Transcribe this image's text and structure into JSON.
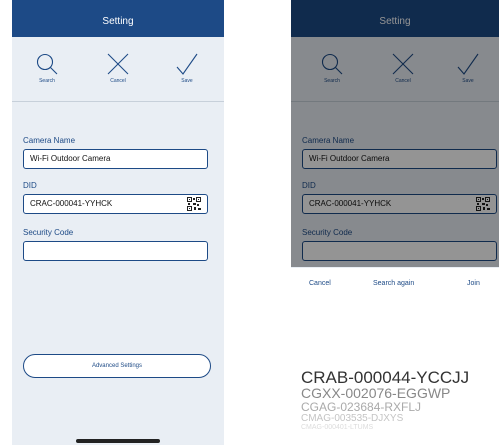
{
  "screen_a": {
    "header_title": "Setting",
    "toolbar": {
      "search_label": "Search",
      "cancel_label": "Cancel",
      "save_label": "Save"
    },
    "camera_name_label": "Camera Name",
    "camera_name_value": "Wi-Fi Outdoor Camera",
    "did_label": "DID",
    "did_value": "CRAC-000041-YYHCK",
    "security_code_label": "Security Code",
    "security_code_value": "",
    "advanced_settings_label": "Advanced Settings"
  },
  "screen_b": {
    "header_title": "Setting",
    "toolbar": {
      "search_label": "Search",
      "cancel_label": "Cancel",
      "save_label": "Save"
    },
    "camera_name_label": "Camera Name",
    "camera_name_value": "Wi-Fi Outdoor Camera",
    "did_label": "DID",
    "did_value": "CRAC-000041-YYHCK",
    "security_code_label": "Security Code",
    "sheet": {
      "cancel_label": "Cancel",
      "search_again_label": "Search again",
      "join_label": "Join",
      "picker_items": [
        "CRAB-000044-YCCJJ",
        "CGXX-002076-EGGWP",
        "CGAG-023684-RXFLJ",
        "CMAG-003535-DJXYS",
        "CMAG-000401-LTUMS"
      ]
    }
  },
  "colors": {
    "header": "#1d4a86",
    "accent": "#1d4a86",
    "background": "#e9eef4"
  },
  "icons": [
    "search-icon",
    "close-icon",
    "checkmark-icon",
    "qr-code-icon"
  ]
}
